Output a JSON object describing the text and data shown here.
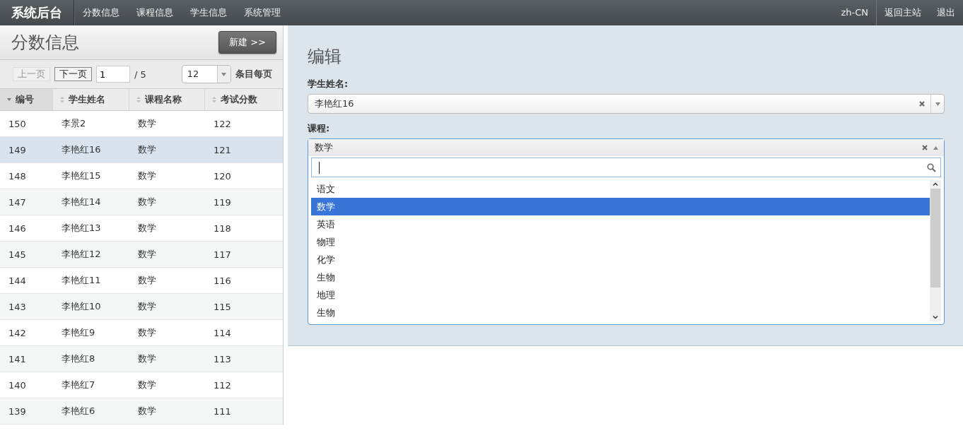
{
  "navbar": {
    "brand": "系统后台",
    "menu": [
      {
        "label": "分数信息"
      },
      {
        "label": "课程信息"
      },
      {
        "label": "学生信息"
      },
      {
        "label": "系统管理"
      }
    ],
    "right": [
      {
        "label": "zh-CN"
      },
      {
        "label": "返回主站"
      },
      {
        "label": "退出"
      }
    ]
  },
  "list_panel": {
    "title": "分数信息",
    "new_button": "新建 >>",
    "pager": {
      "prev": {
        "label": "上一页",
        "disabled": true
      },
      "next": {
        "label": "下一页",
        "disabled": false
      },
      "page": "1",
      "total": "/ 5",
      "page_size": "12",
      "page_size_label": "条目每页"
    },
    "table": {
      "columns": [
        {
          "label": "编号",
          "sorted": true
        },
        {
          "label": "学生姓名",
          "sorted": false
        },
        {
          "label": "课程名称",
          "sorted": false
        },
        {
          "label": "考试分数",
          "sorted": false
        }
      ],
      "rows": [
        {
          "cells": [
            "150",
            "李景2",
            "数学",
            "122"
          ],
          "selected": false
        },
        {
          "cells": [
            "149",
            "李艳红16",
            "数学",
            "121"
          ],
          "selected": true
        },
        {
          "cells": [
            "148",
            "李艳红15",
            "数学",
            "120"
          ],
          "selected": false
        },
        {
          "cells": [
            "147",
            "李艳红14",
            "数学",
            "119"
          ],
          "selected": false
        },
        {
          "cells": [
            "146",
            "李艳红13",
            "数学",
            "118"
          ],
          "selected": false
        },
        {
          "cells": [
            "145",
            "李艳红12",
            "数学",
            "117"
          ],
          "selected": false
        },
        {
          "cells": [
            "144",
            "李艳红11",
            "数学",
            "116"
          ],
          "selected": false
        },
        {
          "cells": [
            "143",
            "李艳红10",
            "数学",
            "115"
          ],
          "selected": false
        },
        {
          "cells": [
            "142",
            "李艳红9",
            "数学",
            "114"
          ],
          "selected": false
        },
        {
          "cells": [
            "141",
            "李艳红8",
            "数学",
            "113"
          ],
          "selected": false
        },
        {
          "cells": [
            "140",
            "李艳红7",
            "数学",
            "112"
          ],
          "selected": false
        },
        {
          "cells": [
            "139",
            "李艳红6",
            "数学",
            "111"
          ],
          "selected": false
        }
      ]
    }
  },
  "edit_panel": {
    "title": "编辑",
    "student_field": {
      "label": "学生姓名:",
      "value": "李艳红16"
    },
    "course_field": {
      "label": "课程:",
      "value": "数学",
      "expanded": true,
      "options": [
        {
          "label": "语文",
          "selected": false
        },
        {
          "label": "数学",
          "selected": true
        },
        {
          "label": "英语",
          "selected": false
        },
        {
          "label": "物理",
          "selected": false
        },
        {
          "label": "化学",
          "selected": false
        },
        {
          "label": "生物",
          "selected": false
        },
        {
          "label": "地理",
          "selected": false
        },
        {
          "label": "生物",
          "selected": false
        }
      ]
    }
  }
}
